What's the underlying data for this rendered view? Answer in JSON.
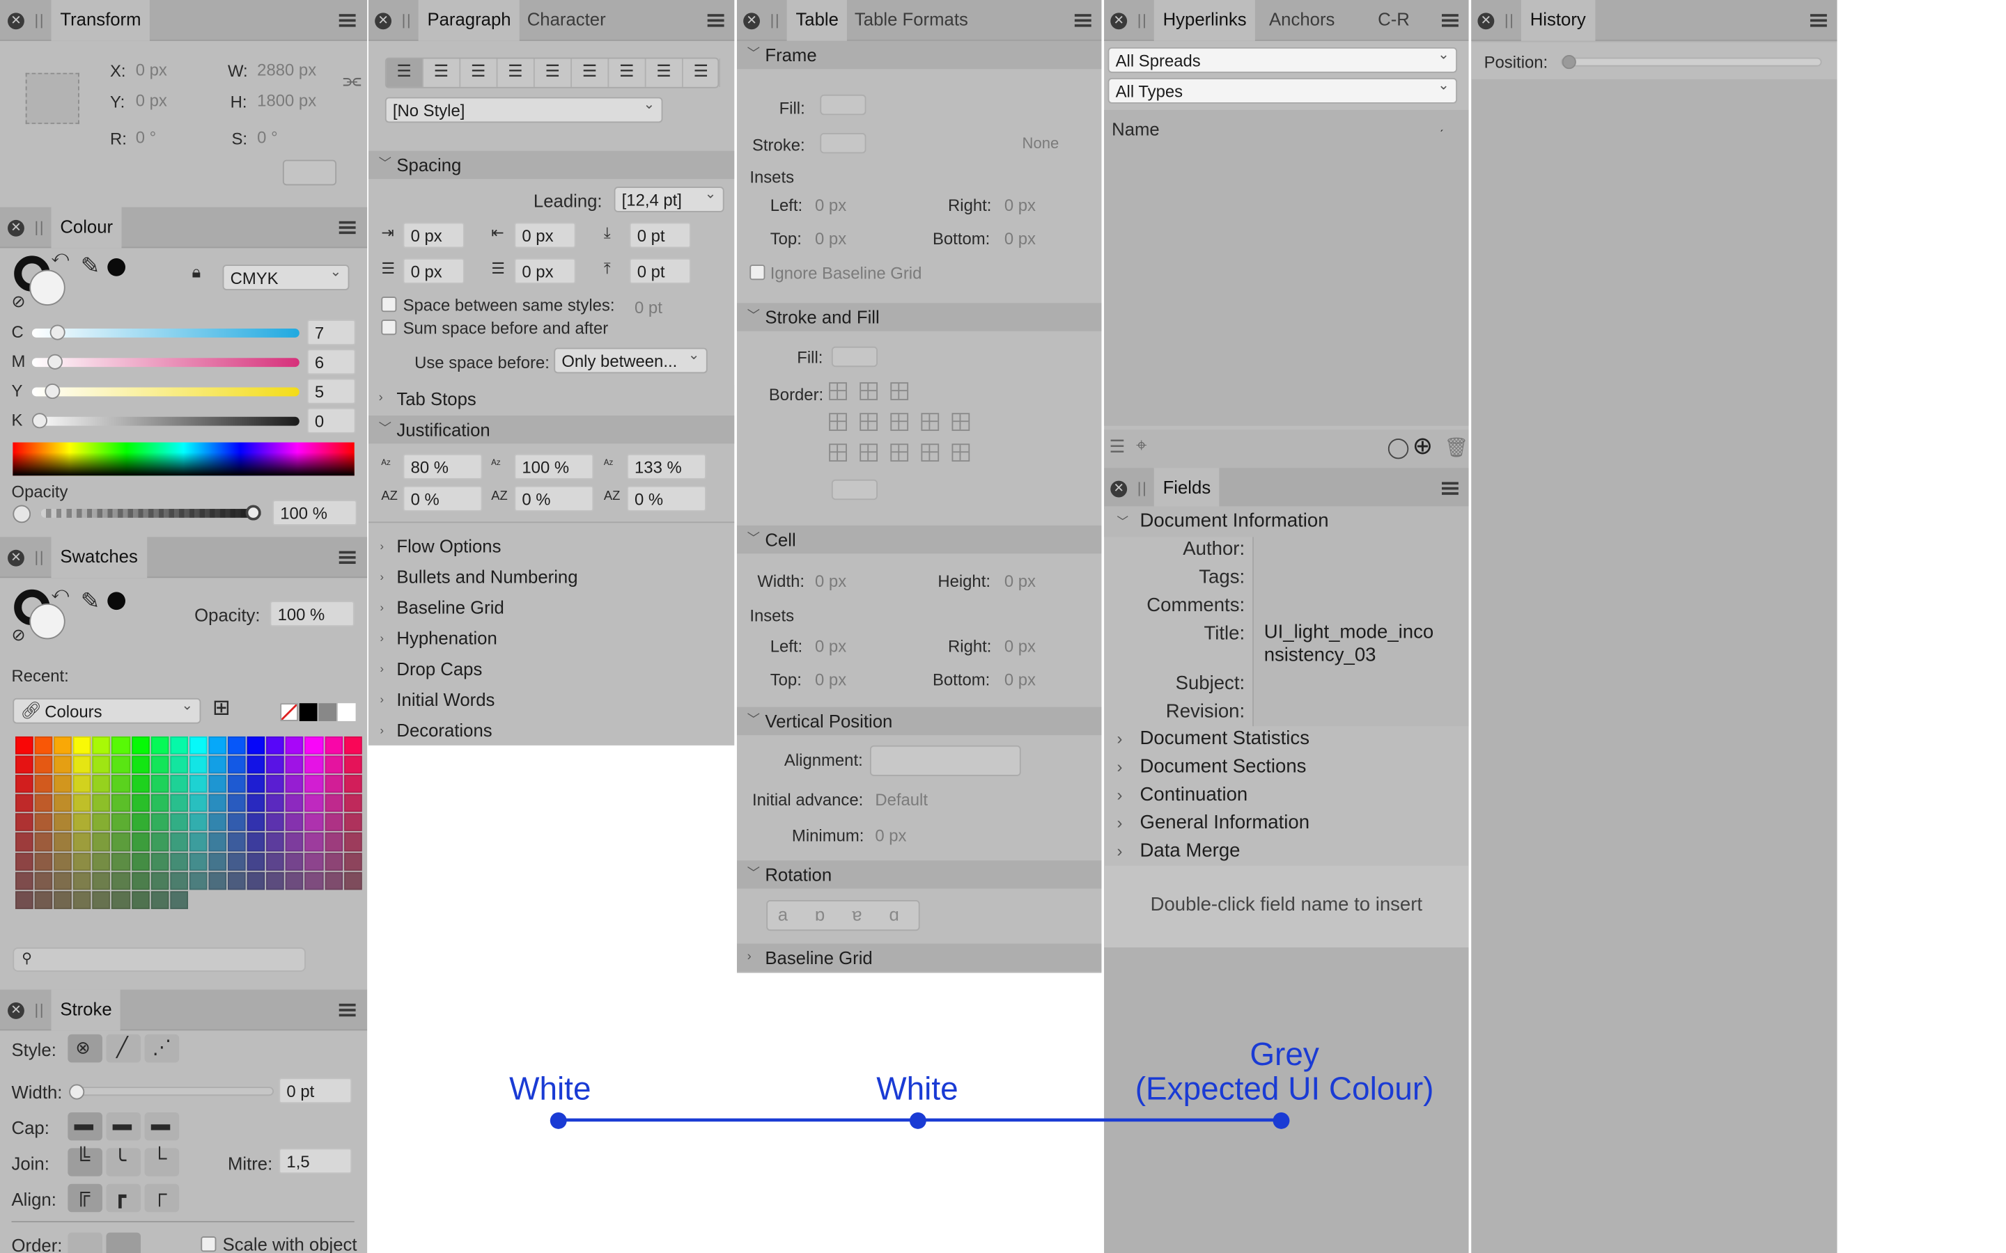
{
  "transform": {
    "tab": "Transform",
    "x_label": "X:",
    "x_value": "0 px",
    "y_label": "Y:",
    "y_value": "0 px",
    "w_label": "W:",
    "w_value": "2880 px",
    "h_label": "H:",
    "h_value": "1800 px",
    "r_label": "R:",
    "r_value": "0 °",
    "s_label": "S:",
    "s_value": "0 °"
  },
  "colour": {
    "tab": "Colour",
    "model": "CMYK",
    "channels": [
      {
        "label": "C",
        "value": "7",
        "level": 0.07
      },
      {
        "label": "M",
        "value": "6",
        "level": 0.06
      },
      {
        "label": "Y",
        "value": "5",
        "level": 0.05
      },
      {
        "label": "K",
        "value": "0",
        "level": 0.0
      }
    ],
    "opacity_label": "Opacity",
    "opacity_value": "100 %"
  },
  "swatches": {
    "tab": "Swatches",
    "opacity_label": "Opacity:",
    "opacity_value": "100 %",
    "recent_label": "Recent:",
    "palette": "Colours"
  },
  "stroke": {
    "tab": "Stroke",
    "style_label": "Style:",
    "width_label": "Width:",
    "width_value": "0 pt",
    "cap_label": "Cap:",
    "join_label": "Join:",
    "mitre_label": "Mitre:",
    "mitre_value": "1,5",
    "align_label": "Align:",
    "order_label": "Order:",
    "scale_label": "Scale with object"
  },
  "paragraph": {
    "tabs": [
      "Paragraph",
      "Character"
    ],
    "style": "[No Style]",
    "spacing": "Spacing",
    "leading_label": "Leading:",
    "leading_value": "[12,4 pt]",
    "indents": [
      "0 px",
      "0 px",
      "0 pt",
      "0 px",
      "0 px",
      "0 pt"
    ],
    "space_same": "Space between same styles:",
    "space_same_value": "0 pt",
    "sum_space": "Sum space before and after",
    "use_space_label": "Use space before:",
    "use_space_value": "Only between...",
    "tab_stops": "Tab Stops",
    "justification": "Justification",
    "just_values": [
      "80 %",
      "100 %",
      "133 %",
      "0 %",
      "0 %",
      "0 %"
    ],
    "sections": [
      "Flow Options",
      "Bullets and Numbering",
      "Baseline Grid",
      "Hyphenation",
      "Drop Caps",
      "Initial Words",
      "Decorations"
    ]
  },
  "table": {
    "tabs": [
      "Table",
      "Table Formats"
    ],
    "frame": "Frame",
    "fill_label": "Fill:",
    "stroke_label": "Stroke:",
    "stroke_none": "None",
    "insets": "Insets",
    "left_label": "Left:",
    "right_label": "Right:",
    "top_label": "Top:",
    "bottom_label": "Bottom:",
    "zero": "0 px",
    "ignore_grid": "Ignore Baseline Grid",
    "stroke_fill": "Stroke and Fill",
    "border_label": "Border:",
    "cell": "Cell",
    "width_label": "Width:",
    "height_label": "Height:",
    "vertical_position": "Vertical Position",
    "alignment_label": "Alignment:",
    "initial_advance_label": "Initial advance:",
    "initial_advance_value": "Default",
    "minimum_label": "Minimum:",
    "minimum_value": "0 px",
    "rotation": "Rotation",
    "rotation_glyphs": [
      "a",
      "ɒ",
      "ɐ",
      "ɑ"
    ],
    "baseline_grid": "Baseline Grid"
  },
  "hyperlinks": {
    "tabs": [
      "Hyperlinks",
      "Anchors",
      "C-R"
    ],
    "spreads": "All Spreads",
    "types": "All Types",
    "name_header": "Name"
  },
  "fields": {
    "tab": "Fields",
    "doc_info": "Document Information",
    "author_label": "Author:",
    "tags_label": "Tags:",
    "comments_label": "Comments:",
    "title_label": "Title:",
    "title_value": "UI_light_mode_inconsistency_03",
    "subject_label": "Subject:",
    "revision_label": "Revision:",
    "groups": [
      "Document Statistics",
      "Document Sections",
      "Continuation",
      "General Information",
      "Data Merge"
    ],
    "hint": "Double-click field name to insert"
  },
  "history": {
    "tab": "History",
    "position_label": "Position:",
    "position_level": 0.0
  },
  "annotations": {
    "white_1": "White",
    "white_2": "White",
    "grey_1": "Grey",
    "grey_2": "(Expected UI Colour)",
    "color": "#1a3bd4"
  }
}
